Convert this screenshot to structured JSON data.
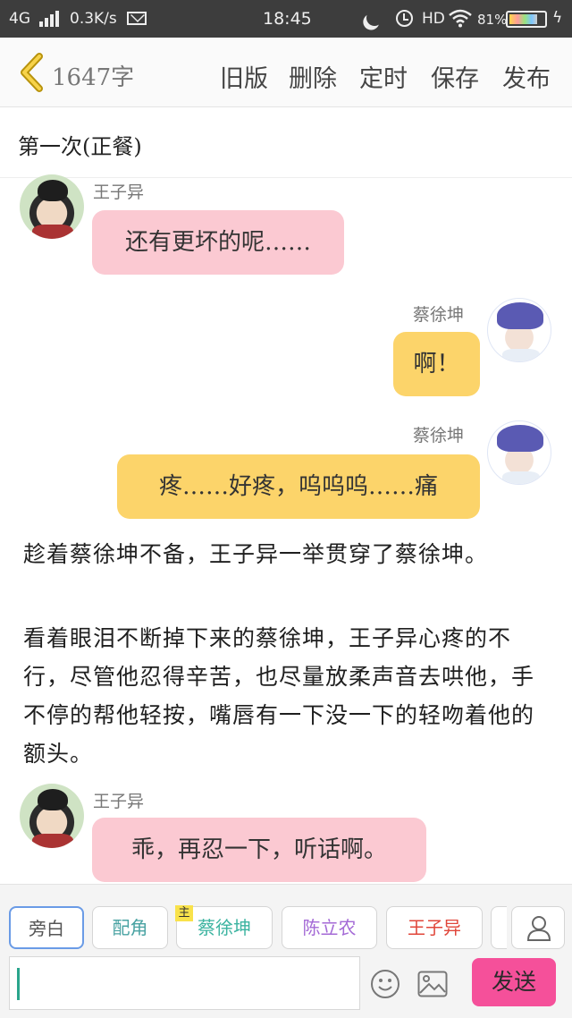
{
  "status_bar": {
    "network": "4G",
    "speed": "0.3K/s",
    "time": "18:45",
    "hd": "HD",
    "battery_pct": "81%"
  },
  "header": {
    "word_count": "1647字",
    "buttons": [
      "旧版",
      "删除",
      "定时",
      "保存",
      "发布"
    ]
  },
  "chapter_title": "第一次(正餐)",
  "messages": [
    {
      "speaker": "王子异",
      "text": "还有更坏的呢……"
    },
    {
      "speaker": "蔡徐坤",
      "text": "啊！"
    },
    {
      "speaker": "蔡徐坤",
      "text": "疼……好疼，呜呜呜……痛"
    },
    {
      "speaker": "王子异",
      "text": "乖，再忍一下，听话啊。"
    }
  ],
  "narration": [
    "趁着蔡徐坤不备，王子异一举贯穿了蔡徐坤。",
    "看着眼泪不断掉下来的蔡徐坤，王子异心疼的不行，尽管他忍得辛苦，也尽量放柔声音去哄他，手不停的帮他轻按，嘴唇有一下没一下的轻吻着他的额头。"
  ],
  "roles": [
    {
      "label": "旁白",
      "color": "#555555"
    },
    {
      "label": "配角",
      "color": "#4aa3a3"
    },
    {
      "label": "蔡徐坤",
      "color": "#3bb3a0",
      "tag": "主"
    },
    {
      "label": "陈立农",
      "color": "#a46ad6"
    },
    {
      "label": "王子异",
      "color": "#e0463a"
    }
  ],
  "composer": {
    "send_label": "发送"
  }
}
